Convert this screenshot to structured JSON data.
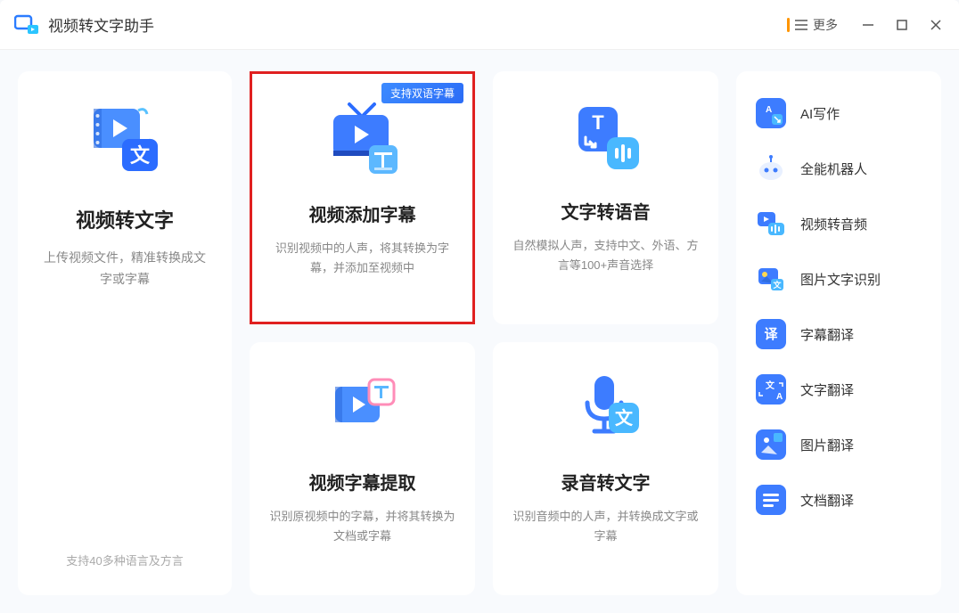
{
  "app": {
    "title": "视频转文字助手",
    "more_label": "更多"
  },
  "left_card": {
    "title": "视频转文字",
    "desc": "上传视频文件，精准转换成文字或字幕",
    "footer": "支持40多种语言及方言"
  },
  "features": [
    {
      "title": "视频添加字幕",
      "desc": "识别视频中的人声，将其转换为字幕，并添加至视频中",
      "badge": "支持双语字幕"
    },
    {
      "title": "文字转语音",
      "desc": "自然模拟人声，支持中文、外语、方言等100+声音选择",
      "badge": ""
    },
    {
      "title": "视频字幕提取",
      "desc": "识别原视频中的字幕，并将其转换为文档或字幕",
      "badge": ""
    },
    {
      "title": "录音转文字",
      "desc": "识别音频中的人声，并转换成文字或字幕",
      "badge": ""
    }
  ],
  "sidebar": {
    "items": [
      {
        "label": "AI写作"
      },
      {
        "label": "全能机器人"
      },
      {
        "label": "视频转音频"
      },
      {
        "label": "图片文字识别"
      },
      {
        "label": "字幕翻译"
      },
      {
        "label": "文字翻译"
      },
      {
        "label": "图片翻译"
      },
      {
        "label": "文档翻译"
      }
    ]
  }
}
